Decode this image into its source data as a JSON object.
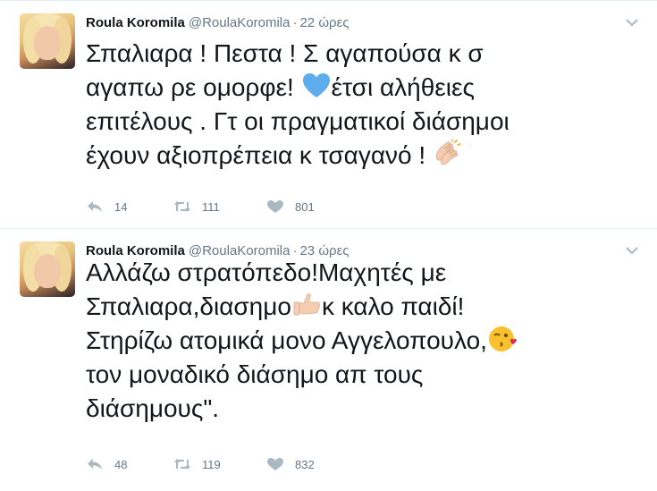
{
  "tweets": [
    {
      "author_name": "Roula Koromila",
      "author_handle": "@RoulaKoromila",
      "separator": "·",
      "time": "22 ώρες",
      "text_parts": [
        "Σπαλιαρα ! Πεστα ! Σ αγαπούσα κ σ\nαγαπω ρε ομορφε! ",
        "έτσι αλήθειες\nεπιτέλους . Γτ οι πραγματικοί διάσημοι\nέχουν αξιοπρέπεια κ τσαγανό ! "
      ],
      "emojis": [
        "blue-heart-icon",
        "clapping-hands-icon"
      ],
      "replies": "14",
      "retweets": "111",
      "likes": "801"
    },
    {
      "author_name": "Roula Koromila",
      "author_handle": "@RoulaKoromila",
      "separator": "·",
      "time": "23 ώρες",
      "text_parts": [
        "Αλλάζω στρατόπεδο!Μαχητές με\nΣπαλιαρα,διασημο",
        "κ καλο παιδί!\nΣτηρίζω ατομικά μονο Αγγελοπουλο,",
        "\nτον μοναδικό διάσημο απ τους\nδιάσημους\"."
      ],
      "emojis": [
        "thumbs-up-icon",
        "face-throwing-kiss-icon"
      ],
      "replies": "48",
      "retweets": "119",
      "likes": "832"
    }
  ],
  "colors": {
    "text": "#14171a",
    "muted": "#657786",
    "icon": "#aab8c2",
    "heart_blue": "#5dadec",
    "divider": "#e6ecf0"
  }
}
